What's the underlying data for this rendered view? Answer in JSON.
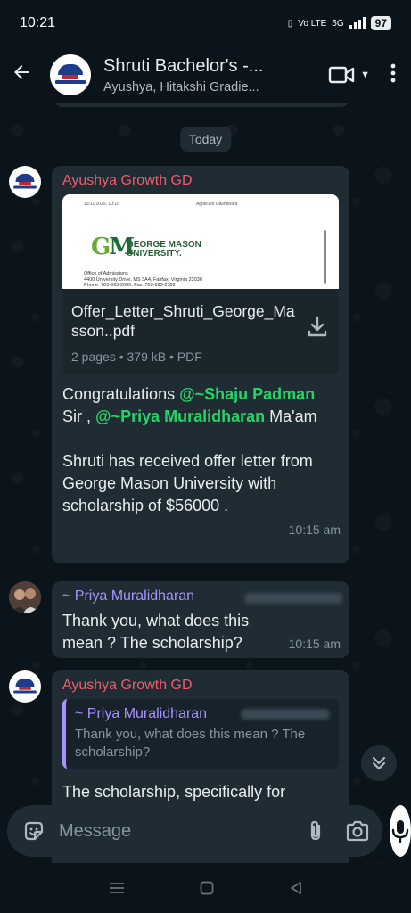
{
  "status_bar": {
    "time": "10:21",
    "network_label": "Vo LTE",
    "signal_label": "5G",
    "battery": "97"
  },
  "header": {
    "title": "Shruti Bachelor's -...",
    "subtitle": "Ayushya, Hitakshi Gradie..."
  },
  "chat": {
    "date_label": "Today",
    "messages": [
      {
        "sender": "Ayushya Growth GD",
        "document": {
          "preview_meta_left": "12/11/2025, 10:15",
          "preview_meta_center": "Applicant Dashboard",
          "preview_university_line1": "GEORGE MASON",
          "preview_university_line2": "UNIVERSITY.",
          "preview_address_line1": "Office of Admissions",
          "preview_address_line2": "4400 University Drive, MS 3A4, Fairfax, Virginia 22030",
          "preview_address_line3": "Phone: 703-993-2000, Fax: 703-993-2392",
          "file_name": "Offer_Letter_Shruti_George_Masson..pdf",
          "pages": "2 pages",
          "size": "379 kB",
          "type": "PDF"
        },
        "text_part1": "Congratulations ",
        "mention1": "@~Shaju Padman",
        "text_part2": " Sir , ",
        "mention2": "@~Priya Muralidharan",
        "text_part3": " Ma'am",
        "text_para2": "Shruti has received offer letter from George Mason University with scholarship of $56000 .",
        "time": "10:15 am"
      },
      {
        "sender": "~ Priya Muralidharan",
        "text": "Thank you,  what does this mean ? The scholarship?",
        "time": "10:15 am"
      },
      {
        "sender": "Ayushya Growth GD",
        "quote_sender": "~ Priya Muralidharan",
        "quote_text": "Thank you,  what does this mean ? The scholarship?",
        "text": "The scholarship, specifically for"
      }
    ]
  },
  "composer": {
    "placeholder": "Message"
  },
  "icons": {
    "back": "back-arrow-icon",
    "video": "video-call-icon",
    "menu": "more-options-icon",
    "download": "download-icon",
    "sticker": "sticker-icon",
    "attach": "attach-icon",
    "camera": "camera-icon",
    "mic": "mic-icon",
    "scroll_down": "double-chevron-down-icon"
  },
  "colors": {
    "background": "#0b141a",
    "bubble": "#1f2c34",
    "mention": "#25d366",
    "sender_ayushya": "#f15c6d",
    "sender_priya": "#a791ff"
  }
}
